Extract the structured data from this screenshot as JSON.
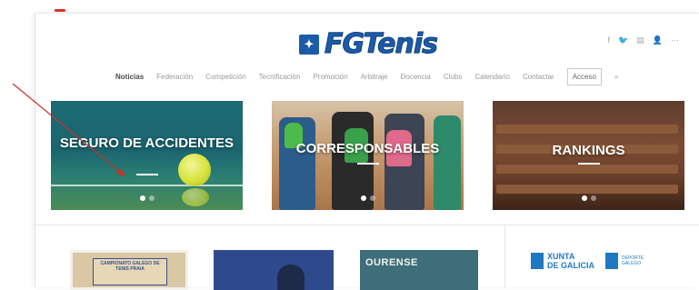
{
  "header": {
    "logo_badge": "✦",
    "logo_text": "FGTenis",
    "social_icons": [
      "f",
      "🐦",
      "▤",
      "👤",
      "⋯"
    ]
  },
  "nav": {
    "items": [
      "Noticias",
      "Federación",
      "Competición",
      "Tecnificación",
      "Promoción",
      "Arbitraje",
      "Docencia",
      "Clubs",
      "Calendario",
      "Contactar"
    ],
    "active": "Noticias",
    "access_label": "Acceso",
    "search_icon": "⌕"
  },
  "slides": [
    {
      "caption": "SEGURO DE ACCIDENTES"
    },
    {
      "caption": "CORRESPONSABLES"
    },
    {
      "caption": "RANKINGS"
    }
  ],
  "lower": {
    "card1_text": "CAMPIONATO GALEGO DE TENIS PRAIA",
    "card3_text": "OURENSE",
    "xunta_line1": "XUNTA",
    "xunta_line2": "DE GALICIA",
    "deporte_line1": "DEPORTE",
    "deporte_line2": "GALEGO"
  },
  "colors": {
    "brand_blue": "#1c5ba8",
    "xunta_blue": "#1f79c2",
    "arrow_red": "#c9302c"
  }
}
